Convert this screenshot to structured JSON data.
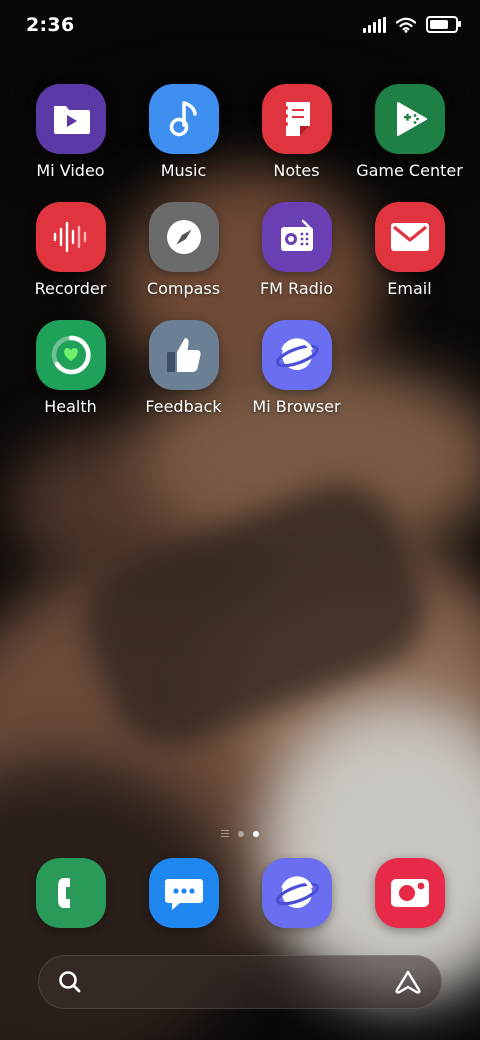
{
  "status_bar": {
    "time": "2:36",
    "icons": [
      "signal-icon",
      "wifi-icon",
      "battery-icon"
    ],
    "battery_level": 0.9
  },
  "apps": [
    {
      "label": "Mi Video",
      "icon": "video-icon",
      "color": "#5b3aa8"
    },
    {
      "label": "Music",
      "icon": "music-icon",
      "color": "#3f8ff0"
    },
    {
      "label": "Notes",
      "icon": "notes-icon",
      "color": "#e0353f"
    },
    {
      "label": "Game Center",
      "icon": "game-center-icon",
      "color": "#1f8046"
    },
    {
      "label": "Recorder",
      "icon": "recorder-icon",
      "color": "#e0353f"
    },
    {
      "label": "Compass",
      "icon": "compass-icon",
      "color": "#6b6b6b"
    },
    {
      "label": "FM Radio",
      "icon": "radio-icon",
      "color": "#6b3fb4"
    },
    {
      "label": "Email",
      "icon": "email-icon",
      "color": "#e0353f"
    },
    {
      "label": "Health",
      "icon": "health-icon",
      "color": "#1fa15a"
    },
    {
      "label": "Feedback",
      "icon": "feedback-icon",
      "color": "#6b7f95"
    },
    {
      "label": "Mi Browser",
      "icon": "browser-icon",
      "color": "#6a6ef0"
    }
  ],
  "page_indicator": {
    "pages": 2,
    "active": 2
  },
  "dock": [
    {
      "icon": "phone-icon",
      "color": "#2a9a58"
    },
    {
      "icon": "messages-icon",
      "color": "#1e88f0"
    },
    {
      "icon": "browser-icon",
      "color": "#6a6ef0"
    },
    {
      "icon": "camera-icon",
      "color": "#e62a48"
    }
  ],
  "search": {
    "left_icon": "search-icon",
    "right_icon": "assistant-icon"
  }
}
